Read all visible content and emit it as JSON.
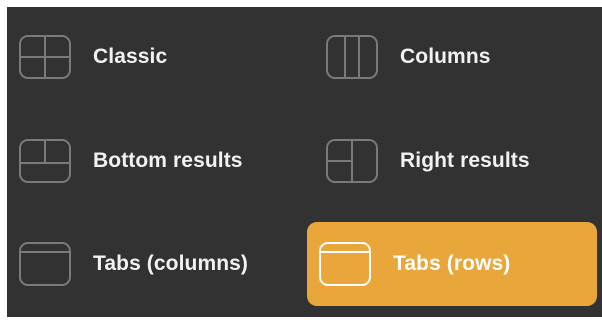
{
  "layout_options": [
    {
      "id": "classic",
      "label": "Classic",
      "icon": "classic-layout-icon",
      "selected": false
    },
    {
      "id": "columns",
      "label": "Columns",
      "icon": "columns-layout-icon",
      "selected": false
    },
    {
      "id": "bottom_results",
      "label": "Bottom results",
      "icon": "bottom-results-layout-icon",
      "selected": false
    },
    {
      "id": "right_results",
      "label": "Right results",
      "icon": "right-results-layout-icon",
      "selected": false
    },
    {
      "id": "tabs_columns",
      "label": "Tabs (columns)",
      "icon": "tabs-columns-layout-icon",
      "selected": false
    },
    {
      "id": "tabs_rows",
      "label": "Tabs (rows)",
      "icon": "tabs-rows-layout-icon",
      "selected": true
    }
  ],
  "colors": {
    "panel_background": "#323232",
    "selected_background": "#e9a63a",
    "label_text": "#f2f2f2",
    "icon_stroke": "#7a7a7a",
    "selected_icon_stroke": "#ffffff"
  }
}
